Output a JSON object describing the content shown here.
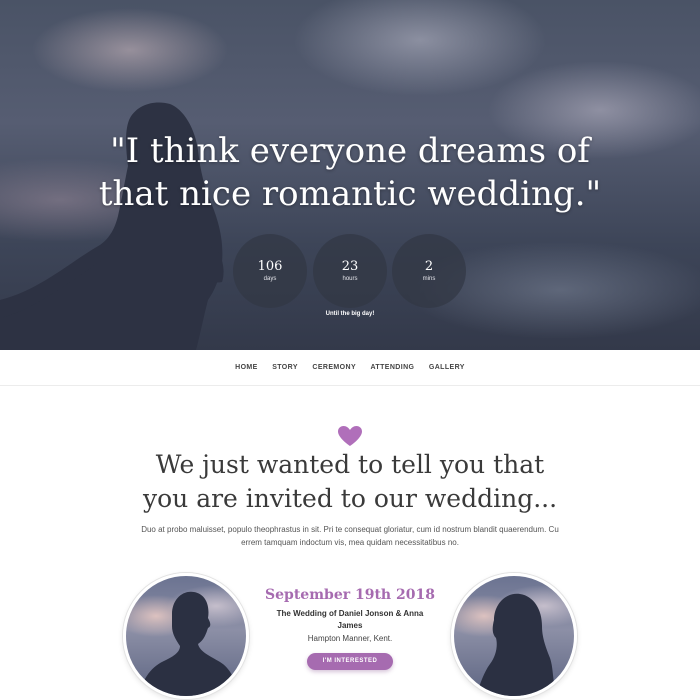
{
  "hero": {
    "quote_line1": "\"I think everyone dreams of",
    "quote_line2": "that nice romantic wedding.\"",
    "countdown": [
      {
        "value": "106",
        "unit": "days"
      },
      {
        "value": "23",
        "unit": "hours"
      },
      {
        "value": "2",
        "unit": "mins"
      }
    ],
    "until_text": "Until the big day!"
  },
  "nav": {
    "items": [
      "HOME",
      "STORY",
      "CEREMONY",
      "ATTENDING",
      "GALLERY"
    ]
  },
  "invite": {
    "icon": "heart-icon",
    "heading_line1": "We just wanted to tell you that",
    "heading_line2": "you are invited to our wedding...",
    "body": "Duo at probo maluisset, populo theophrastus in sit. Pri te consequat gloriatur, cum id nostrum blandit quaerendum. Cu errem tamquam indoctum vis, mea quidam necessitatibus no."
  },
  "event": {
    "date": "September 19th 2018",
    "title": "The Wedding of Daniel Jonson & Anna James",
    "location": "Hampton Manner, Kent.",
    "button_label": "I'M INTERESTED"
  },
  "colors": {
    "accent": "#a66bb0",
    "heart": "#b06fba",
    "text": "#3a3a3a"
  }
}
